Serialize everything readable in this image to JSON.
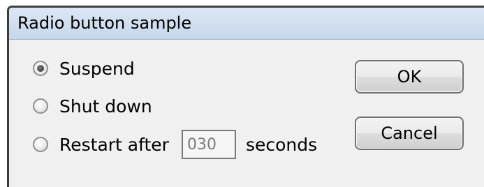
{
  "window": {
    "title": "Radio button sample"
  },
  "options": [
    {
      "label": "Suspend",
      "selected": true
    },
    {
      "label": "Shut down",
      "selected": false
    },
    {
      "label": "Restart after",
      "selected": false
    }
  ],
  "restart": {
    "seconds_value": "030",
    "seconds_label": "seconds"
  },
  "buttons": {
    "ok_label": "OK",
    "cancel_label": "Cancel"
  }
}
